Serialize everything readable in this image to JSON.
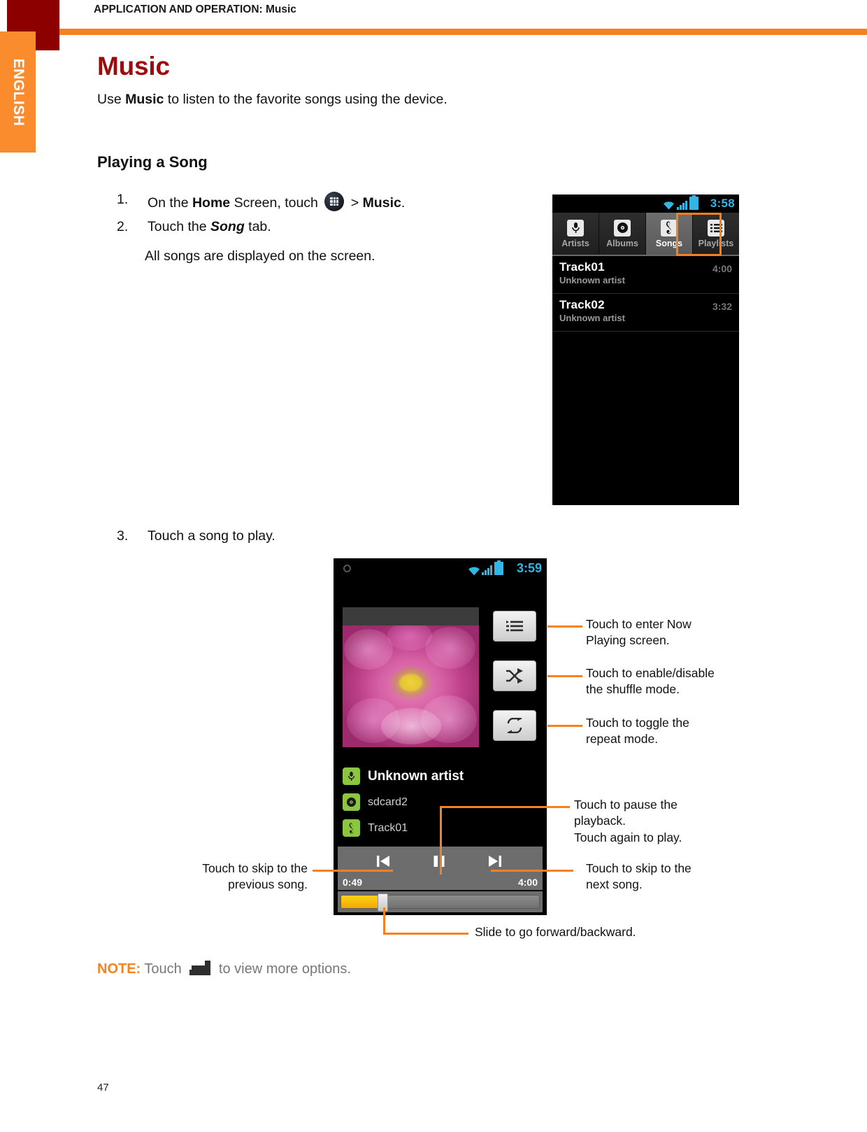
{
  "header": {
    "breadcrumb_bold": "APPLICATION AND OPERATION:",
    "breadcrumb_rest": " Music",
    "language_tab": "ENGLISH"
  },
  "page": {
    "number": "47",
    "title": "Music",
    "intro_prefix": "Use ",
    "intro_bold": "Music",
    "intro_suffix": " to listen to the favorite songs using the device.",
    "section_heading": "Playing a Song"
  },
  "steps": [
    {
      "num": "1.",
      "pre": "On the ",
      "bold1": "Home",
      "mid": " Screen, touch ",
      "icon": "app-drawer-icon",
      "post": " > ",
      "bold2": "Music",
      "end": "."
    },
    {
      "num": "2.",
      "pre": "Touch the ",
      "italic": "Song",
      "post": " tab."
    },
    {
      "num": "3.",
      "text": "Touch a song to play."
    }
  ],
  "substep": "All songs are displayed on the screen.",
  "note": {
    "label": "NOTE:",
    "pre": " Touch ",
    "icon": "menu-icon",
    "post": " to view more options."
  },
  "phone1": {
    "status": {
      "time": "3:58",
      "icons": [
        "wifi-icon",
        "signal-icon",
        "battery-icon"
      ]
    },
    "tabs": [
      {
        "label": "Artists",
        "icon": "microphone-icon",
        "glyph": "Ἲ4",
        "selected": false
      },
      {
        "label": "Albums",
        "icon": "disc-icon",
        "glyph": "◉",
        "selected": false
      },
      {
        "label": "Songs",
        "icon": "treble-clef-icon",
        "glyph": "ᴑE",
        "selected": true
      },
      {
        "label": "Playlists",
        "icon": "list-icon",
        "glyph": "☰",
        "selected": false
      }
    ],
    "songs": [
      {
        "title": "Track01",
        "artist": "Unknown artist",
        "duration": "4:00"
      },
      {
        "title": "Track02",
        "artist": "Unknown artist",
        "duration": "3:32"
      }
    ]
  },
  "phone2": {
    "status": {
      "time": "3:59",
      "icons": [
        "wifi-icon",
        "signal-icon",
        "battery-icon"
      ]
    },
    "album_art": "flower-album-art",
    "side_buttons": [
      {
        "icon": "now-playing-list-icon",
        "name": "now-playing-button"
      },
      {
        "icon": "shuffle-icon",
        "name": "shuffle-button"
      },
      {
        "icon": "repeat-icon",
        "name": "repeat-button"
      }
    ],
    "meta": [
      {
        "icon": "microphone-icon",
        "text": "Unknown artist"
      },
      {
        "icon": "disc-icon",
        "text": "sdcard2"
      },
      {
        "icon": "treble-clef-icon",
        "text": "Track01"
      }
    ],
    "controls": {
      "previous": "previous-icon",
      "play_pause": "pause-icon",
      "next": "next-icon",
      "elapsed": "0:49",
      "total": "4:00",
      "progress_percent": 20
    }
  },
  "callouts": {
    "now_playing": "Touch to enter Now\nPlaying screen.",
    "now_playing_l1": "Touch to enter Now",
    "now_playing_l2": "Playing screen.",
    "shuffle_l1": "Touch to enable/disable",
    "shuffle_l2": "the shuffle mode.",
    "repeat_l1": "Touch to toggle the",
    "repeat_l2": "repeat mode.",
    "pause_l1": "Touch to pause the",
    "pause_l2": "playback.",
    "pause_l3": "Touch again to play.",
    "next_l1": "Touch to skip to the",
    "next_l2": "next song.",
    "prev_l1": "Touch to skip to the",
    "prev_l2": "previous song.",
    "slider": "Slide to go forward/backward."
  },
  "colors": {
    "accent_orange": "#F5821F",
    "title_red": "#9E0B0F",
    "header_square": "#8C0000",
    "android_blue": "#33B5E5",
    "android_green": "#8CC63E",
    "seek_fill": "#F2A900"
  }
}
